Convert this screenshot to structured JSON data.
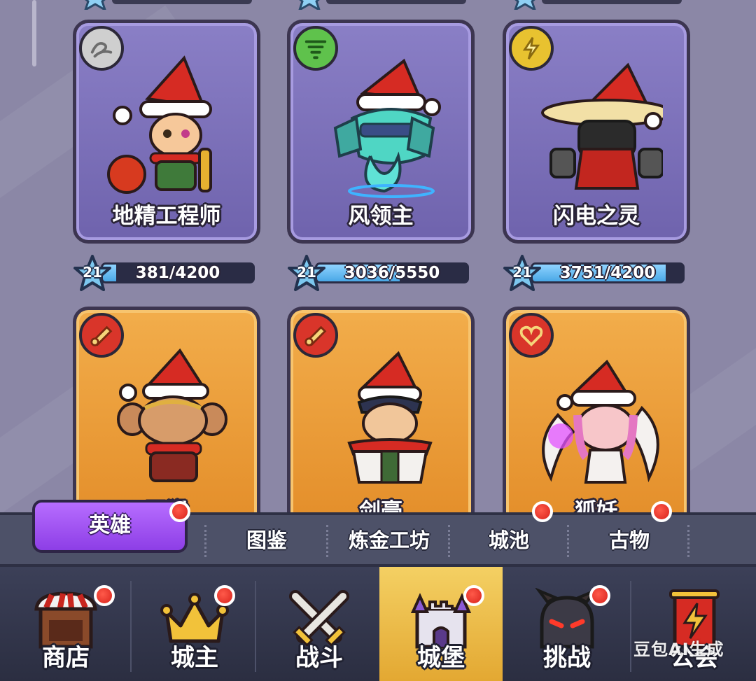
{
  "heroes": [
    {
      "name": "地精工程师",
      "element_icon": "wind-gray-icon",
      "element_color": "#b8b8b8",
      "card_color": "purple",
      "level": "21",
      "progress_text": "381/4200",
      "progress": 0.09
    },
    {
      "name": "风领主",
      "element_icon": "tornado-icon",
      "element_color": "#5fc24c",
      "card_color": "purple",
      "level": "21",
      "progress_text": "3036/5550",
      "progress": 0.55
    },
    {
      "name": "闪电之灵",
      "element_icon": "lightning-icon",
      "element_color": "#e8c230",
      "card_color": "purple",
      "level": "21",
      "progress_text": "3751/4200",
      "progress": 0.89
    },
    {
      "name": "石猴",
      "element_icon": "scroll-icon",
      "element_color": "#d9352a",
      "card_color": "orange"
    },
    {
      "name": "剑豪",
      "element_icon": "scroll-icon",
      "element_color": "#d9352a",
      "card_color": "orange"
    },
    {
      "name": "狐妖",
      "element_icon": "heart-icon",
      "element_color": "#d9352a",
      "card_color": "orange"
    }
  ],
  "subtabs": {
    "active": "英雄",
    "items": [
      "图鉴",
      "炼金工坊",
      "城池",
      "古物"
    ]
  },
  "nav": {
    "items": [
      "商店",
      "城主",
      "战斗",
      "城堡",
      "挑战",
      "公会"
    ],
    "active": "城堡"
  },
  "watermark": "豆包AI生成"
}
